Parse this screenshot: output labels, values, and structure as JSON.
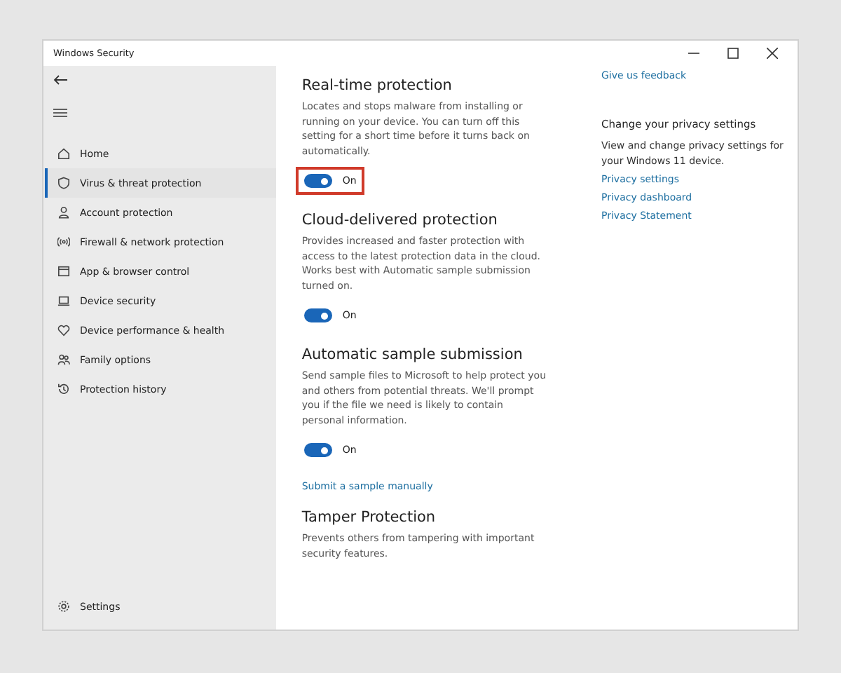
{
  "window": {
    "title": "Windows Security"
  },
  "sidebar": {
    "items": [
      {
        "label": "Home",
        "selected": false
      },
      {
        "label": "Virus & threat protection",
        "selected": true
      },
      {
        "label": "Account protection",
        "selected": false
      },
      {
        "label": "Firewall & network protection",
        "selected": false
      },
      {
        "label": "App & browser control",
        "selected": false
      },
      {
        "label": "Device security",
        "selected": false
      },
      {
        "label": "Device performance & health",
        "selected": false
      },
      {
        "label": "Family options",
        "selected": false
      },
      {
        "label": "Protection history",
        "selected": false
      }
    ],
    "settings_label": "Settings"
  },
  "sections": [
    {
      "title": "Real-time protection",
      "description": "Locates and stops malware from installing or running on your device. You can turn off this setting for a short time before it turns back on automatically.",
      "toggle": {
        "on": true,
        "label": "On",
        "highlighted": true
      }
    },
    {
      "title": "Cloud-delivered protection",
      "description": "Provides increased and faster protection with access to the latest protection data in the cloud. Works best with Automatic sample submission turned on.",
      "toggle": {
        "on": true,
        "label": "On",
        "highlighted": false
      }
    },
    {
      "title": "Automatic sample submission",
      "description": "Send sample files to Microsoft to help protect you and others from potential threats. We'll prompt you if the file we need is likely to contain personal information.",
      "toggle": {
        "on": true,
        "label": "On",
        "highlighted": false
      },
      "link": "Submit a sample manually"
    },
    {
      "title": "Tamper Protection",
      "description": "Prevents others from tampering with important security features."
    }
  ],
  "aside": {
    "feedback_link": "Give us feedback",
    "heading": "Change your privacy settings",
    "text": "View and change privacy settings for your Windows 11 device.",
    "links": [
      "Privacy settings",
      "Privacy dashboard",
      "Privacy Statement"
    ]
  }
}
